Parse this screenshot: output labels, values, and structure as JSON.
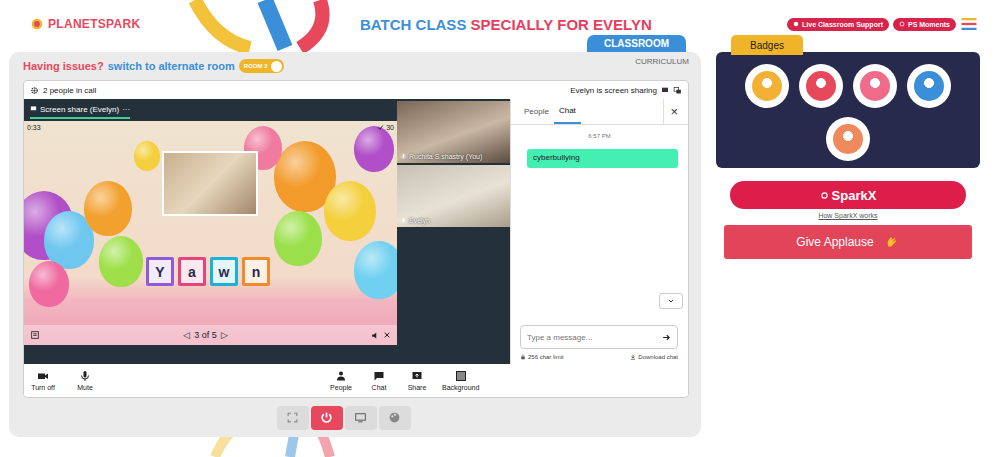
{
  "logo": "PLANETSPARK",
  "header": {
    "title_a": "BATCH CLASS",
    "title_b": "SPECIALLY FOR EVELYN",
    "support": "Live Classroom Support",
    "moments": "PS Moments"
  },
  "tabs": [
    {
      "label": "CLASSROOM",
      "selected": true
    },
    {
      "label": "CURRICULUM",
      "selected": false
    }
  ],
  "notice": {
    "text": "Having issues?",
    "link": "switch to alternate room",
    "toggle": "ROOM 2"
  },
  "call": {
    "people_count": "2 people in call",
    "sharing": "Evelyn is screen sharing",
    "share_title": "Screen share (Evelyn)",
    "more": "···"
  },
  "slide": {
    "time": "0:33",
    "count": "30",
    "page": "3 of 5",
    "prev": "◁",
    "next": "▷",
    "word": [
      {
        "letter": "Y",
        "color": "#8e5bd8"
      },
      {
        "letter": "a",
        "color": "#e4457c"
      },
      {
        "letter": "w",
        "color": "#1fb0d6"
      },
      {
        "letter": "n",
        "color": "#ef8b2c"
      }
    ]
  },
  "participants": [
    {
      "name": "Ruchita S shastry (You)"
    },
    {
      "name": "Evelyn"
    }
  ],
  "chat": {
    "tabs": [
      {
        "label": "People",
        "selected": false
      },
      {
        "label": "Chat",
        "selected": true
      }
    ],
    "close": "×",
    "messages": [
      {
        "time": "6:57 PM",
        "text": "cyberbullying"
      }
    ],
    "placeholder": "Type a message...",
    "limit": "256 char limit",
    "download": "Download chat"
  },
  "toolbar": {
    "left": [
      {
        "label": "Turn off"
      },
      {
        "label": "Mute"
      }
    ],
    "center": [
      {
        "label": "People"
      },
      {
        "label": "Chat"
      },
      {
        "label": "Share"
      },
      {
        "label": "Background"
      }
    ]
  },
  "controls": [
    {
      "kind": "fullscreen",
      "active": false
    },
    {
      "kind": "power",
      "active": true
    },
    {
      "kind": "screen",
      "active": false
    },
    {
      "kind": "palette",
      "active": false
    }
  ],
  "badges": {
    "title": "Badges",
    "items": [
      {
        "color": "#f2b134"
      },
      {
        "color": "#e8485c"
      },
      {
        "color": "#f06a8a"
      },
      {
        "color": "#3a8fd8"
      },
      {
        "color": "#f08a5c"
      }
    ]
  },
  "sparkx": {
    "label": "SparkX",
    "help": "How SparkX works"
  },
  "applause": {
    "label": "Give Applause"
  }
}
